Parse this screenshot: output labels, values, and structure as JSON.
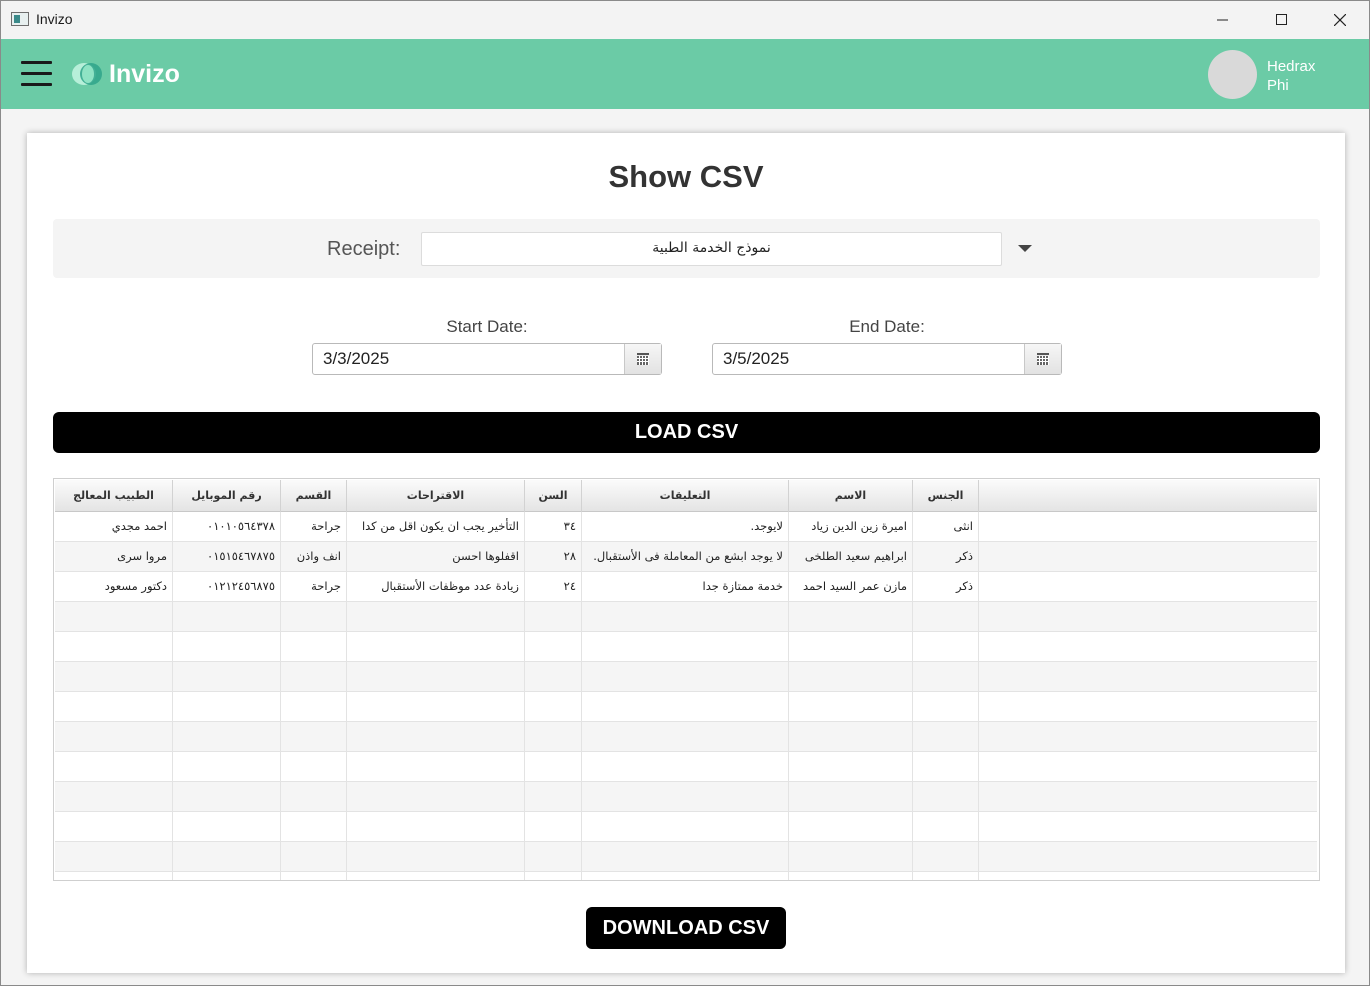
{
  "window": {
    "title": "Invizo"
  },
  "header": {
    "logo_text": "Invizo",
    "user": {
      "first_name": "Hedrax",
      "last_name": "Phi"
    },
    "colors": {
      "header_bg": "#6bcba6",
      "logo_mark_dark": "#2fa58a",
      "logo_mark_light": "#b7efd9"
    }
  },
  "main": {
    "title": "Show CSV",
    "receipt": {
      "label": "Receipt:",
      "value": "نموذج الخدمة الطبية"
    },
    "start_date": {
      "label": "Start Date:",
      "value": "3/3/2025"
    },
    "end_date": {
      "label": "End Date:",
      "value": "3/5/2025"
    },
    "load_label": "LOAD CSV",
    "download_label": "DOWNLOAD CSV"
  },
  "table": {
    "columns": [
      "الجنس",
      "الاسم",
      "التعليقات",
      "السن",
      "الاقتراحات",
      "القسم",
      "رقم الموبايل",
      "الطبيب المعالج"
    ],
    "rows": [
      [
        "انثى",
        "اميرة زين الدين زياد",
        "لايوجد.",
        "٣٤",
        "التأخير يجب ان يكون اقل من كدا",
        "جراحة",
        "٠١٠١٠٥٦٤٣٧٨",
        "احمد مجدي"
      ],
      [
        "ذكر",
        "ابراهيم سعيد الطلخى",
        "لا يوجد ابشع من المعاملة فى الأستقبال.",
        "٢٨",
        "اقفلوها احسن",
        "انف واذن",
        "٠١٥١٥٤٦٧٨٧٥",
        "مروا سرى"
      ],
      [
        "ذكر",
        "مازن عمر السيد احمد",
        "خدمة ممتازة جدا",
        "٢٤",
        "زيادة عدد موظفات الأستقبال",
        "جراحة",
        "٠١٢١٢٤٥٦٨٧٥",
        "دكتور مسعود"
      ]
    ],
    "empty_rows": 9
  }
}
